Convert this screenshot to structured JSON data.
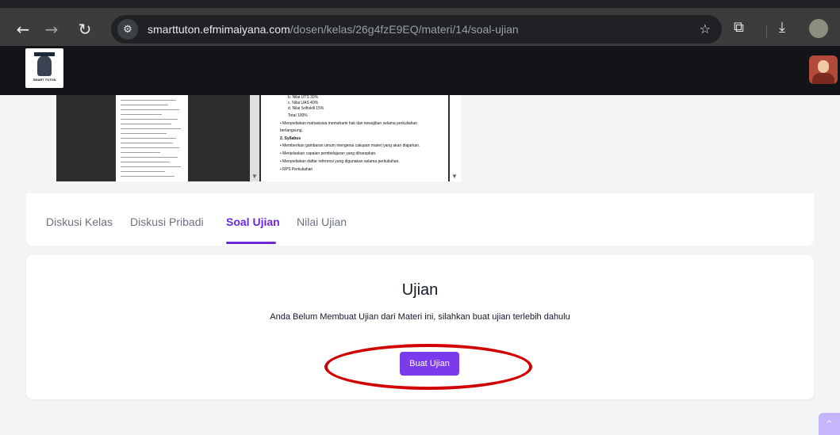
{
  "browser": {
    "url_host": "smarttuton.efmimaiyana.com",
    "url_path": "/dosen/kelas/26g4fzE9EQ/materi/14/soal-ujian",
    "icons": [
      "back-arrow-icon",
      "forward-arrow-icon",
      "reload-icon",
      "site-info-icon",
      "star-icon",
      "extensions-icon",
      "download-icon",
      "profile-icon"
    ]
  },
  "header": {
    "logo_text": "SMART TUTON"
  },
  "document_preview": {
    "lines": [
      "b.  Nilai UTS          30%",
      "c.  Nilai UAS          40%",
      "d.  Nilai Softskill    15%",
      "     Total             100%",
      "•  Menyediakan mahasiswa memahami hak dan kewajiban selama perkuliahan",
      "    berlangsung.",
      "2.  Syllabus",
      "•  Memberikan gambaran umum mengenai cakupan materi yang akan diajarkan.",
      "•  Menjelaskan capaian pembelajaran yang diharapkan.",
      "•  Menyediakan daftar referensi yang digunakan selama perkuliahan.",
      "•  RPS Perkuliahan"
    ]
  },
  "tabs": [
    {
      "label": "Diskusi Kelas",
      "active": false
    },
    {
      "label": "Diskusi Pribadi",
      "active": false
    },
    {
      "label": "Soal Ujian",
      "active": true
    },
    {
      "label": "Nilai Ujian",
      "active": false
    }
  ],
  "ujian": {
    "title": "Ujian",
    "description": "Anda Belum Membuat Ujian dari Materi ini, silahkan buat ujian terlebih dahulu",
    "button_label": "Buat Ujian"
  },
  "colors": {
    "accent": "#7c3aed",
    "tab_active": "#6d28d9",
    "highlight": "#d10000"
  }
}
